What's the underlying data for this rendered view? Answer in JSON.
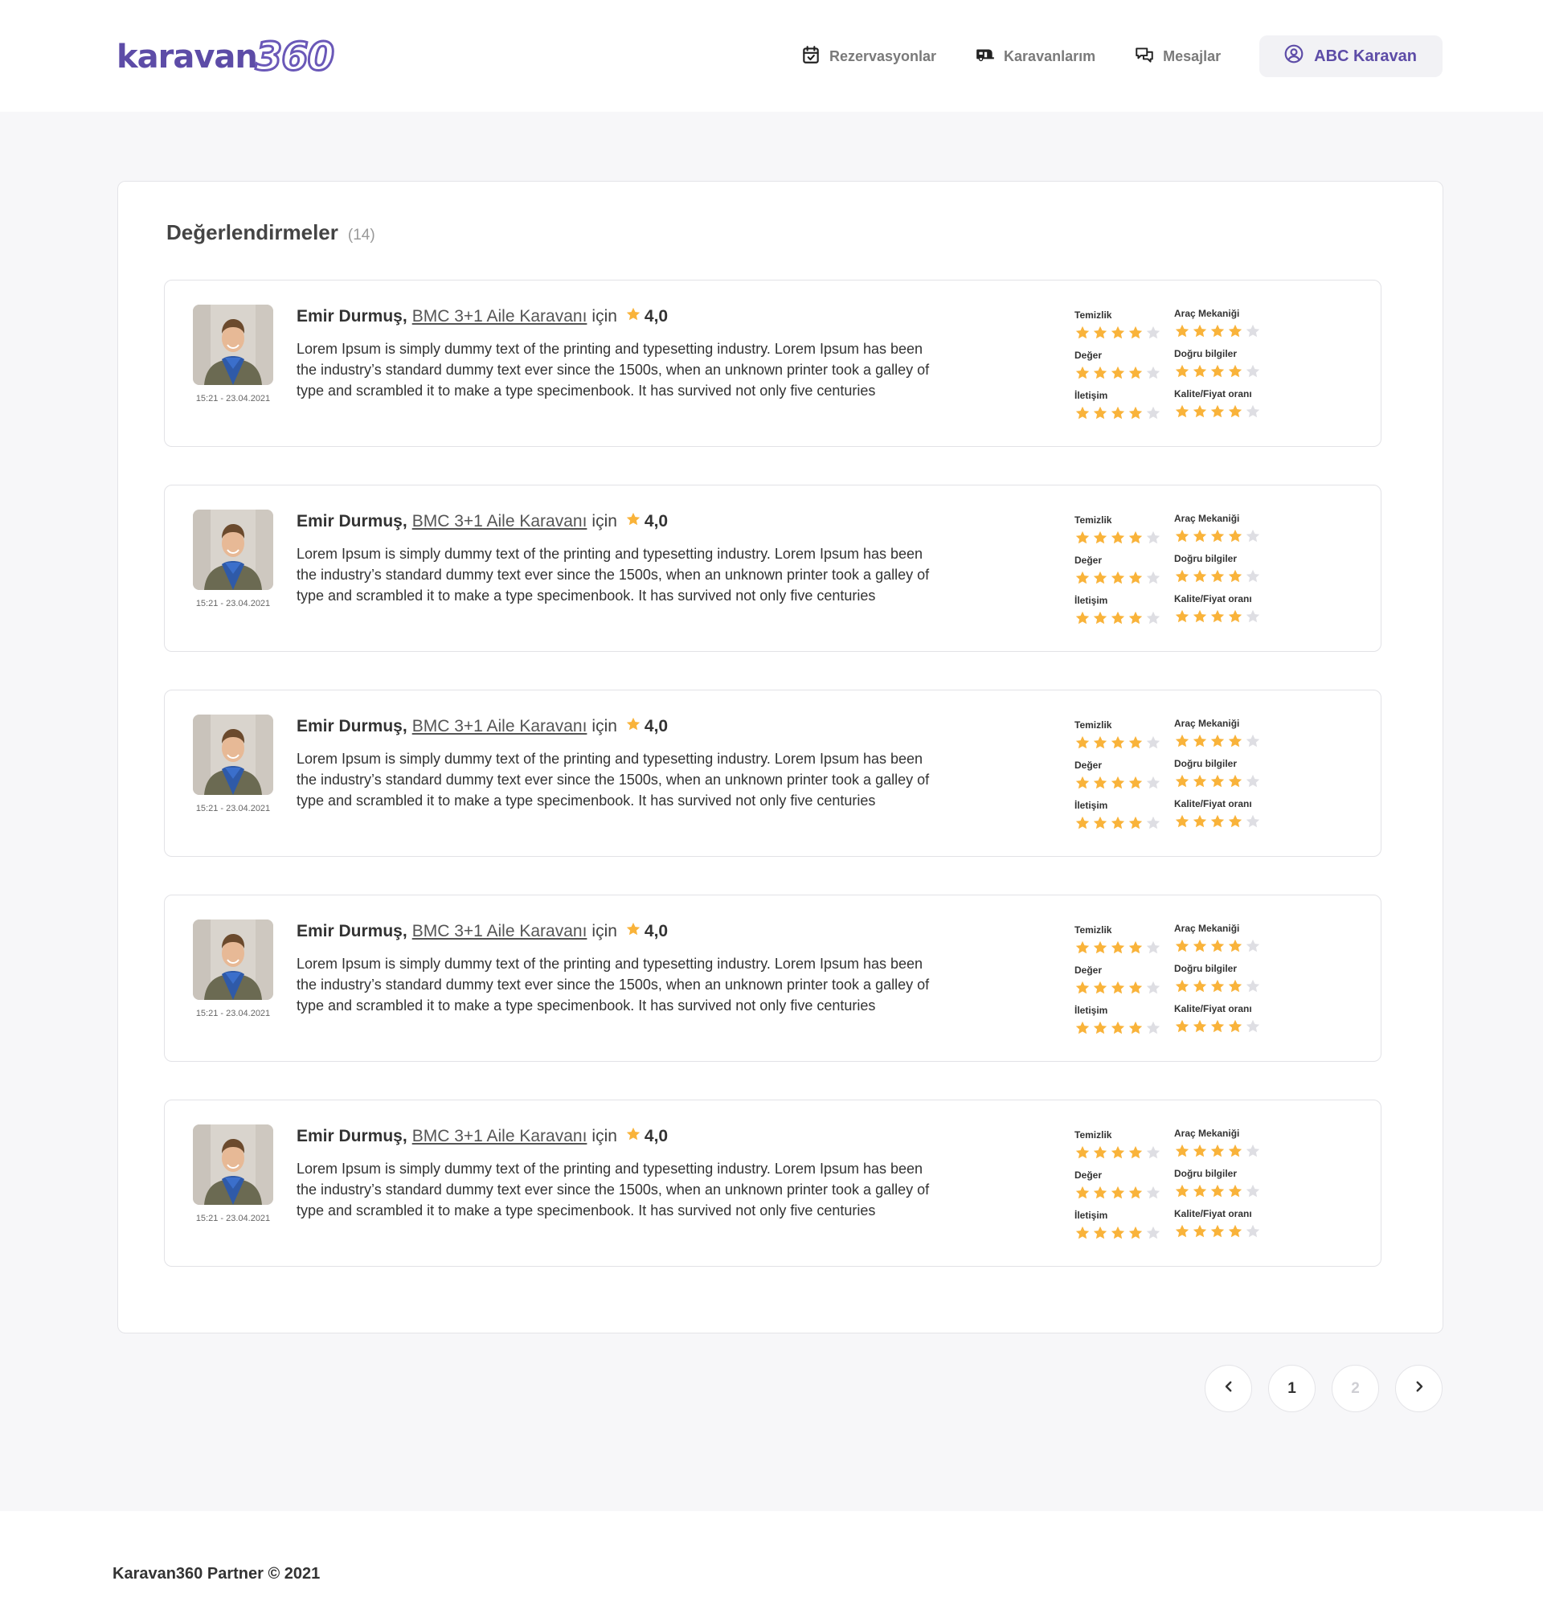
{
  "brand": {
    "word": "karavan",
    "num": "360"
  },
  "nav": {
    "items": [
      {
        "label": "Rezervasyonlar",
        "icon": "calendar-check-icon"
      },
      {
        "label": "Karavanlarım",
        "icon": "caravan-icon"
      },
      {
        "label": "Mesajlar",
        "icon": "chat-bubbles-icon"
      }
    ],
    "user": {
      "label": "ABC Karavan",
      "icon": "user-circle-icon"
    }
  },
  "reviews_section": {
    "title": "Değerlendirmeler",
    "count": "(14)"
  },
  "colors": {
    "accent": "#5d4ca7",
    "star": "#f9b33a",
    "star_empty": "#dedee3"
  },
  "rating_labels": [
    "Temizlik",
    "Araç Mekaniği",
    "Değer",
    "Doğru bilgiler",
    "İletişim",
    "Kalite/Fiyat oranı"
  ],
  "reviews": [
    {
      "name": "Emir Durmuş,",
      "vehicle": "BMC 3+1 Aile Karavanı",
      "for": "için",
      "score": "4,0",
      "date": "15:21 - 23.04.2021",
      "text": "Lorem Ipsum is simply dummy text of the printing and typesetting industry. Lorem Ipsum has been the industry’s standard dummy text ever since the 1500s, when an unknown printer took a galley of type and scrambled it to make a type specimenbook. It has survived not only five centuries",
      "ratings": [
        4,
        4,
        4,
        4,
        4,
        4
      ]
    },
    {
      "name": "Emir Durmuş,",
      "vehicle": "BMC 3+1 Aile Karavanı",
      "for": "için",
      "score": "4,0",
      "date": "15:21 - 23.04.2021",
      "text": "Lorem Ipsum is simply dummy text of the printing and typesetting industry. Lorem Ipsum has been the industry’s standard dummy text ever since the 1500s, when an unknown printer took a galley of type and scrambled it to make a type specimenbook. It has survived not only five centuries",
      "ratings": [
        4,
        4,
        4,
        4,
        4,
        4
      ]
    },
    {
      "name": "Emir Durmuş,",
      "vehicle": "BMC 3+1 Aile Karavanı",
      "for": "için",
      "score": "4,0",
      "date": "15:21 - 23.04.2021",
      "text": "Lorem Ipsum is simply dummy text of the printing and typesetting industry. Lorem Ipsum has been the industry’s standard dummy text ever since the 1500s, when an unknown printer took a galley of type and scrambled it to make a type specimenbook. It has survived not only five centuries",
      "ratings": [
        4,
        4,
        4,
        4,
        4,
        4
      ]
    },
    {
      "name": "Emir Durmuş,",
      "vehicle": "BMC 3+1 Aile Karavanı",
      "for": "için",
      "score": "4,0",
      "date": "15:21 - 23.04.2021",
      "text": "Lorem Ipsum is simply dummy text of the printing and typesetting industry. Lorem Ipsum has been the industry’s standard dummy text ever since the 1500s, when an unknown printer took a galley of type and scrambled it to make a type specimenbook. It has survived not only five centuries",
      "ratings": [
        4,
        4,
        4,
        4,
        4,
        4
      ]
    },
    {
      "name": "Emir Durmuş,",
      "vehicle": "BMC 3+1 Aile Karavanı",
      "for": "için",
      "score": "4,0",
      "date": "15:21 - 23.04.2021",
      "text": "Lorem Ipsum is simply dummy text of the printing and typesetting industry. Lorem Ipsum has been the industry’s standard dummy text ever since the 1500s, when an unknown printer took a galley of type and scrambled it to make a type specimenbook. It has survived not only five centuries",
      "ratings": [
        4,
        4,
        4,
        4,
        4,
        4
      ]
    }
  ],
  "pagination": {
    "prev_icon": "chevron-left-icon",
    "pages": [
      "1",
      "2"
    ],
    "current": "1",
    "next_icon": "chevron-right-icon"
  },
  "footer": {
    "text": "Karavan360 Partner © 2021"
  }
}
